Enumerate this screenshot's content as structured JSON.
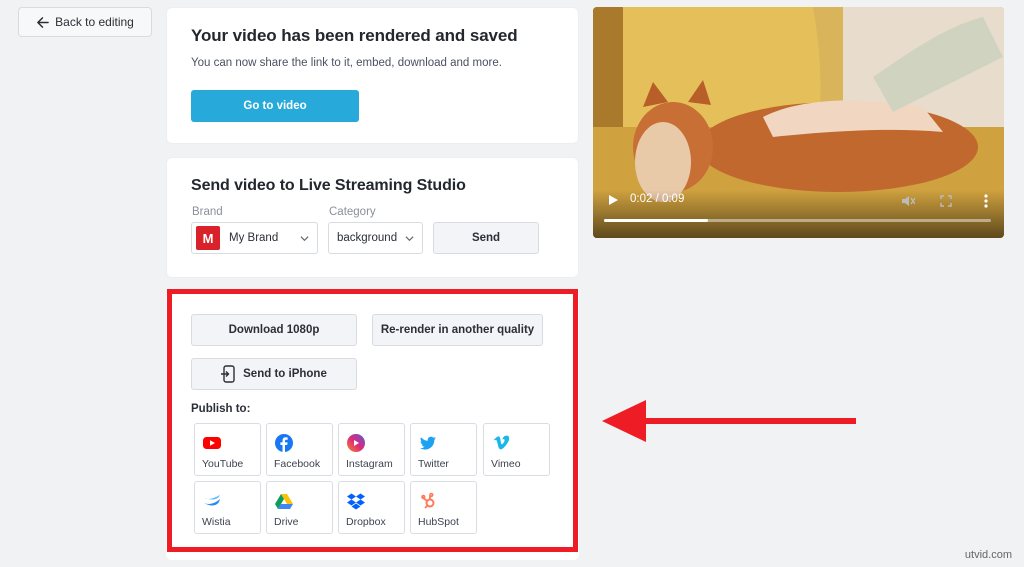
{
  "back_button": {
    "label": "Back to editing"
  },
  "rendered": {
    "title": "Your video has been rendered and saved",
    "subtitle": "You can now share the link to it, embed, download and more.",
    "go_button": "Go to video"
  },
  "studio": {
    "title": "Send video to Live Streaming Studio",
    "brand_label": "Brand",
    "brand_value": "My Brand",
    "brand_logo_letter": "M",
    "category_label": "Category",
    "category_value": "background",
    "send_button": "Send"
  },
  "download": {
    "download_button": "Download 1080p",
    "rerender_button": "Re-render in another quality",
    "iphone_button": "Send to iPhone",
    "publish_label": "Publish to:",
    "platforms": [
      {
        "label": "YouTube",
        "icon": "youtube-icon",
        "color": "#ff0000"
      },
      {
        "label": "Facebook",
        "icon": "facebook-icon",
        "color": "#1877f2"
      },
      {
        "label": "Instagram",
        "icon": "instagram-icon",
        "color": "#c13584"
      },
      {
        "label": "Twitter",
        "icon": "twitter-icon",
        "color": "#1da1f2"
      },
      {
        "label": "Vimeo",
        "icon": "vimeo-icon",
        "color": "#1ab7ea"
      },
      {
        "label": "Wistia",
        "icon": "wistia-icon",
        "color": "#2a8bf2"
      },
      {
        "label": "Drive",
        "icon": "google-drive-icon",
        "color": "#0f9d58"
      },
      {
        "label": "Dropbox",
        "icon": "dropbox-icon",
        "color": "#0061ff"
      },
      {
        "label": "HubSpot",
        "icon": "hubspot-icon",
        "color": "#ff7a59"
      }
    ]
  },
  "video": {
    "time": "0:02 / 0:09",
    "progress": 0.27
  },
  "watermark": "utvid.com",
  "colors": {
    "accent": "#27aad9",
    "highlight": "#ee1c24",
    "brand_logo": "#d8232a"
  }
}
